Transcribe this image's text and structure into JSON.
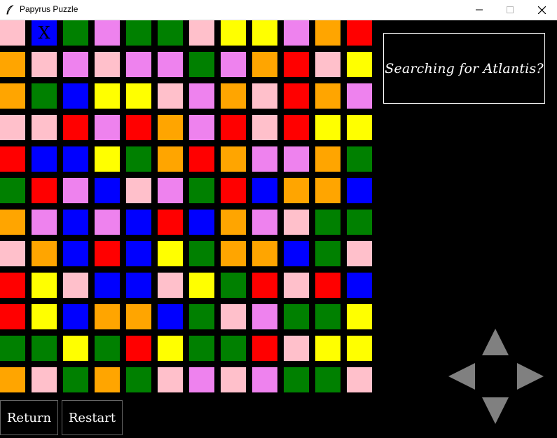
{
  "window": {
    "title": "Papyrus Puzzle"
  },
  "board": {
    "marker_text": "X",
    "marker_position": {
      "row": 0,
      "col": 1
    },
    "colors": {
      "pink": "#ffc0cb",
      "blue": "#0000ff",
      "green": "#008000",
      "violet": "#ee82ee",
      "yellow": "#ffff00",
      "orange": "#ffa500",
      "red": "#ff0000"
    },
    "rows": [
      [
        "pink",
        "blue",
        "green",
        "violet",
        "green",
        "green",
        "pink",
        "yellow",
        "yellow",
        "violet",
        "orange",
        "red"
      ],
      [
        "orange",
        "pink",
        "violet",
        "pink",
        "violet",
        "violet",
        "green",
        "violet",
        "orange",
        "red",
        "pink",
        "yellow"
      ],
      [
        "orange",
        "green",
        "blue",
        "yellow",
        "yellow",
        "pink",
        "violet",
        "orange",
        "pink",
        "red",
        "orange",
        "violet"
      ],
      [
        "pink",
        "pink",
        "red",
        "violet",
        "red",
        "orange",
        "violet",
        "red",
        "pink",
        "red",
        "yellow",
        "yellow"
      ],
      [
        "red",
        "blue",
        "blue",
        "yellow",
        "green",
        "orange",
        "red",
        "orange",
        "violet",
        "violet",
        "orange",
        "green"
      ],
      [
        "green",
        "red",
        "violet",
        "blue",
        "pink",
        "violet",
        "green",
        "red",
        "blue",
        "orange",
        "orange",
        "blue"
      ],
      [
        "orange",
        "violet",
        "blue",
        "violet",
        "blue",
        "red",
        "blue",
        "orange",
        "violet",
        "pink",
        "green",
        "green"
      ],
      [
        "pink",
        "orange",
        "blue",
        "red",
        "blue",
        "yellow",
        "green",
        "orange",
        "orange",
        "blue",
        "green",
        "pink"
      ],
      [
        "red",
        "yellow",
        "pink",
        "blue",
        "blue",
        "pink",
        "yellow",
        "green",
        "red",
        "pink",
        "red",
        "blue"
      ],
      [
        "red",
        "yellow",
        "blue",
        "orange",
        "orange",
        "blue",
        "green",
        "pink",
        "violet",
        "green",
        "green",
        "yellow"
      ],
      [
        "green",
        "green",
        "yellow",
        "green",
        "red",
        "yellow",
        "green",
        "green",
        "red",
        "pink",
        "yellow",
        "yellow"
      ],
      [
        "orange",
        "pink",
        "green",
        "orange",
        "green",
        "pink",
        "violet",
        "pink",
        "violet",
        "green",
        "green",
        "pink"
      ]
    ]
  },
  "message": {
    "text": "Searching for Atlantis?"
  },
  "buttons": {
    "return_label": "Return",
    "restart_label": "Restart"
  },
  "controls": {
    "arrow_color": "#808080",
    "icons": [
      "arrow-up-icon",
      "arrow-left-icon",
      "arrow-right-icon",
      "arrow-down-icon"
    ]
  }
}
